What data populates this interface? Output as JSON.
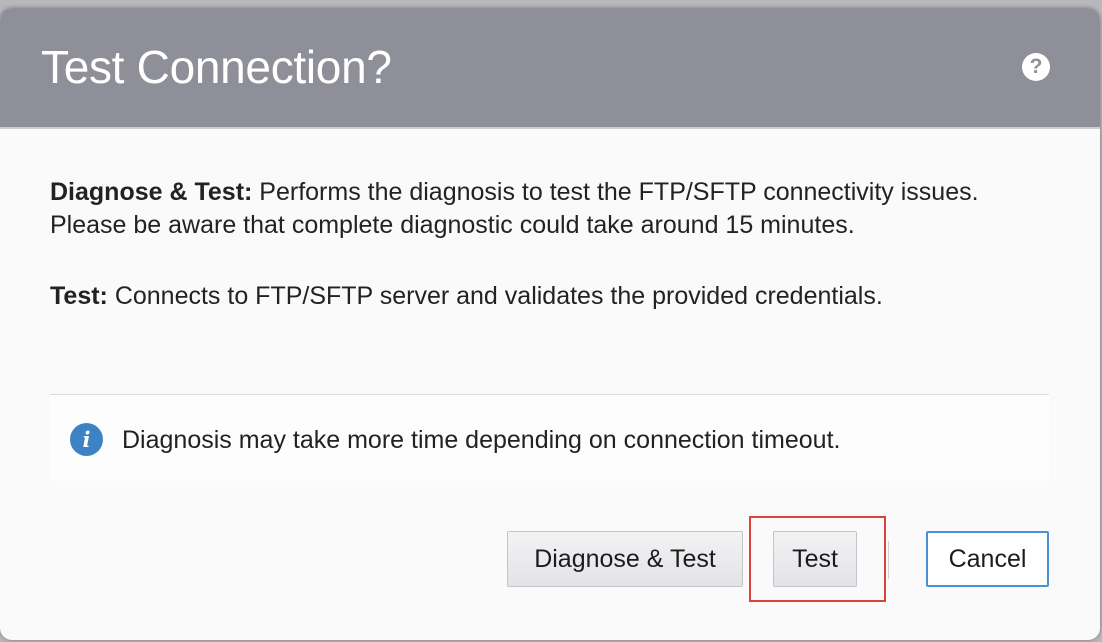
{
  "dialog": {
    "title": "Test Connection?",
    "help_icon": "question-icon",
    "paragraphs": [
      {
        "term": "Diagnose & Test:",
        "text": " Performs the diagnosis to test the FTP/SFTP connectivity issues. Please be aware that complete diagnostic could take around 15 minutes."
      },
      {
        "term": "Test:",
        "text": " Connects to FTP/SFTP server and validates the provided credentials."
      }
    ],
    "info": {
      "icon": "info-icon",
      "text": "Diagnosis may take more time depending on connection timeout."
    },
    "buttons": {
      "diagnose_test": "Diagnose & Test",
      "test": "Test",
      "cancel": "Cancel"
    },
    "colors": {
      "header_bg": "#8e8f98",
      "info_icon": "#3d82c5",
      "highlight": "#d9433b",
      "focus": "#4a8fd9"
    }
  }
}
